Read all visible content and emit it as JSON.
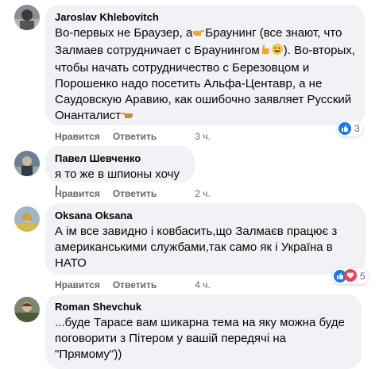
{
  "comments": [
    {
      "author": "Jaroslav Khlebovitch",
      "lines": [
        "Во-первых не Браузер, а",
        "Браунинг (все знают, что",
        "Залмаев сотрудничает с Браунингом",
        "). Во-вторых,",
        "чтобы начать сотрудничество с Березовцом и",
        "Порошенко надо посетить Альфа-Центавр, а не",
        "Саудовскую Аравию, как ошибочно заявляет Русский",
        "Онанталист"
      ],
      "like_label": "Нравится",
      "reply_label": "Ответить",
      "time": "3 ч.",
      "reactions": "3"
    },
    {
      "author": "Павел Шевченко",
      "lines": [
        "я то же в шпионы хочу !"
      ],
      "like_label": "Нравится",
      "reply_label": "Ответить",
      "time": "2 ч."
    },
    {
      "author": "Oksana Oksana",
      "lines": [
        "А ім все завидно і ковбасить,що Залмаєв працює з",
        "американськими службами,так само як і Україна в",
        "НАТО"
      ],
      "like_label": "Нравится",
      "reply_label": "Ответить",
      "time": "4 ч.",
      "reactions": "5"
    },
    {
      "author": "Roman Shevchuk",
      "lines": [
        "...буде Тарасе вам шикарна тема на яку можна буде",
        "поговорити з Пітером у вашій передячі на",
        "\"Прямому\"))"
      ]
    }
  ],
  "icons": {
    "reaction_like": "thumbs-up-icon",
    "reaction_haha": "haha-icon",
    "reaction_love": "heart-icon"
  },
  "colors": {
    "bubble": "#f0f2f5",
    "meta": "#65676b",
    "like_blue": "#1877f2"
  }
}
